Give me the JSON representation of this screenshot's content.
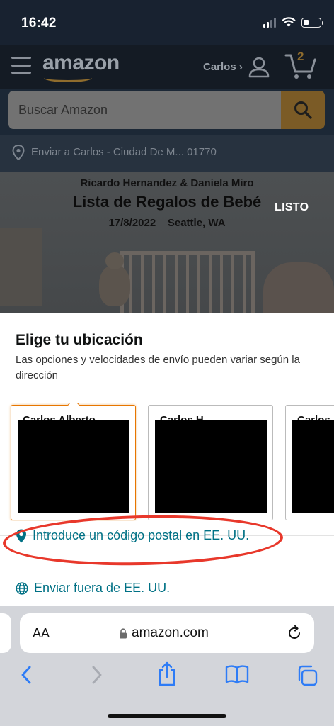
{
  "status_bar": {
    "time": "16:42"
  },
  "header": {
    "logo": "amazon",
    "account_label": "Carlos ›",
    "cart_count": "2"
  },
  "search": {
    "placeholder": "Buscar Amazon"
  },
  "deliver": {
    "text": "Enviar a Carlos - Ciudad De M... 01770"
  },
  "banner": {
    "names": "Ricardo Hernandez & Daniela Miro",
    "title": "Lista de Regalos de Bebé",
    "date": "17/8/2022    Seattle, WA",
    "done_label": "LISTO"
  },
  "sheet": {
    "title": "Elige tu ubicación",
    "subtitle": "Las opciones y velocidades de envío pueden variar según la dirección",
    "addresses": [
      {
        "name": "Carlos Alberto",
        "selected": true
      },
      {
        "name": "Carlos H",
        "selected": false
      },
      {
        "name": "Carlos",
        "selected": false
      }
    ],
    "zip_link": "Introduce un código postal en EE. UU.",
    "outside_link": "Enviar fuera de EE. UU."
  },
  "safari": {
    "aa_label": "AA",
    "url": "amazon.com"
  },
  "colors": {
    "link": "#007185",
    "selected_border": "#e77600",
    "annotation_red": "#e8382b",
    "safari_blue": "#2e7cf6"
  }
}
